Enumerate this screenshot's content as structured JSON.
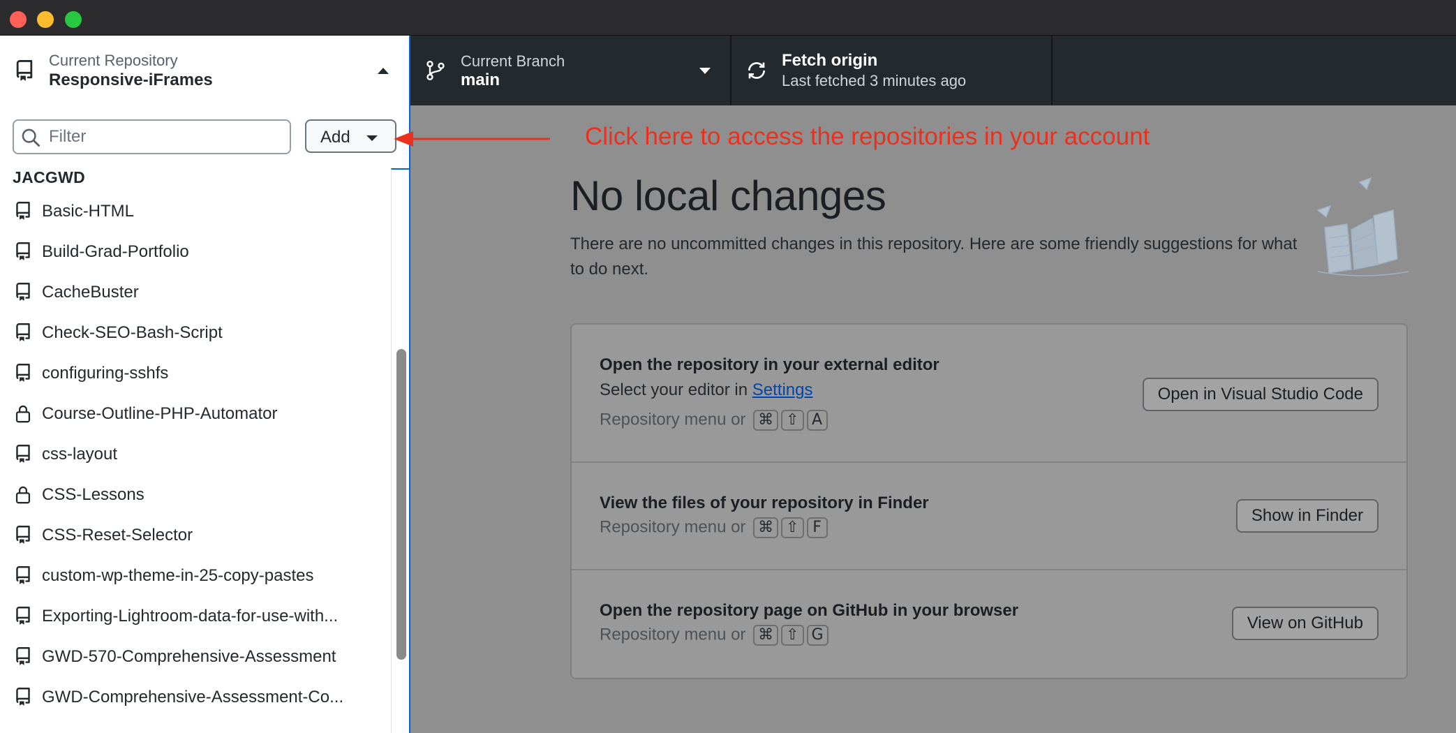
{
  "window": {
    "controls": [
      "close",
      "minimize",
      "zoom"
    ]
  },
  "sidebar": {
    "repo_header": {
      "sub": "Current Repository",
      "main": "Responsive-iFrames"
    },
    "filter": {
      "placeholder": "Filter",
      "value": ""
    },
    "add_button": {
      "label": "Add"
    },
    "group": "JACGWD",
    "repos": [
      {
        "name": "Basic-HTML",
        "icon": "repo-icon"
      },
      {
        "name": "Build-Grad-Portfolio",
        "icon": "repo-icon"
      },
      {
        "name": "CacheBuster",
        "icon": "repo-icon"
      },
      {
        "name": "Check-SEO-Bash-Script",
        "icon": "repo-icon"
      },
      {
        "name": "configuring-sshfs",
        "icon": "repo-icon"
      },
      {
        "name": "Course-Outline-PHP-Automator",
        "icon": "lock-icon"
      },
      {
        "name": "css-layout",
        "icon": "repo-icon"
      },
      {
        "name": "CSS-Lessons",
        "icon": "lock-icon"
      },
      {
        "name": "CSS-Reset-Selector",
        "icon": "repo-icon"
      },
      {
        "name": "custom-wp-theme-in-25-copy-pastes",
        "icon": "repo-icon"
      },
      {
        "name": "Exporting-Lightroom-data-for-use-with...",
        "icon": "repo-icon"
      },
      {
        "name": "GWD-570-Comprehensive-Assessment",
        "icon": "repo-icon"
      },
      {
        "name": "GWD-Comprehensive-Assessment-Co...",
        "icon": "repo-icon"
      }
    ]
  },
  "toolbar": {
    "branch": {
      "sub": "Current Branch",
      "main": "main"
    },
    "fetch": {
      "main": "Fetch origin",
      "sub": "Last fetched 3 minutes ago"
    }
  },
  "annotation": {
    "text": "Click here to access  the repositories in your account",
    "color": "#e8321e"
  },
  "main": {
    "headline": "No local changes",
    "description": "There are no uncommitted changes in this repository. Here are some friendly suggestions for what to do next.",
    "cards": {
      "editor": {
        "title": "Open the repository in your external editor",
        "line_prefix": "Select your editor in ",
        "line_link": "Settings",
        "shortcut_prefix": "Repository menu or",
        "keys": [
          "⌘",
          "⇧",
          "A"
        ],
        "button": "Open in Visual Studio Code"
      },
      "finder": {
        "title": "View the files of your repository in Finder",
        "shortcut_prefix": "Repository menu or",
        "keys": [
          "⌘",
          "⇧",
          "F"
        ],
        "button": "Show in Finder"
      },
      "github": {
        "title": "Open the repository page on GitHub in your browser",
        "shortcut_prefix": "Repository menu or",
        "keys": [
          "⌘",
          "⇧",
          "G"
        ],
        "button": "View on GitHub"
      }
    }
  },
  "colors": {
    "toolbar_bg": "#24292e",
    "overlay": "#8f8f8f",
    "focus_blue": "#0366d6",
    "link": "#0346a8"
  }
}
